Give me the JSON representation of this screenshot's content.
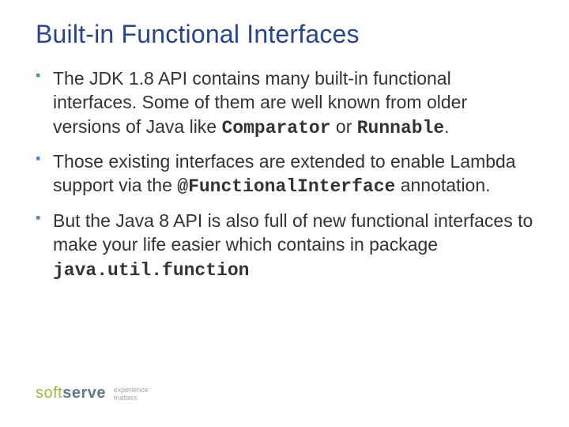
{
  "title": "Built-in Functional Interfaces",
  "bullets": [
    {
      "pre": "The JDK 1.8 API contains many built-in functional interfaces. Some of them are well known from older versions of Java like ",
      "code1": "Comparator",
      "mid": " or ",
      "code2": "Runnable",
      "post": "."
    },
    {
      "pre": "Those existing interfaces are extended to enable Lambda support via the ",
      "code1": "@FunctionalInterface",
      "mid": "",
      "code2": "",
      "post": " annotation."
    },
    {
      "pre": "But the Java 8 API is also full of new functional interfaces to make your life easier which contains in package ",
      "code1": "java.util.function",
      "mid": "",
      "code2": "",
      "post": ""
    }
  ],
  "logo": {
    "part1": "soft",
    "part2": "serve",
    "tagline1": "experience",
    "tagline2": "matters"
  }
}
